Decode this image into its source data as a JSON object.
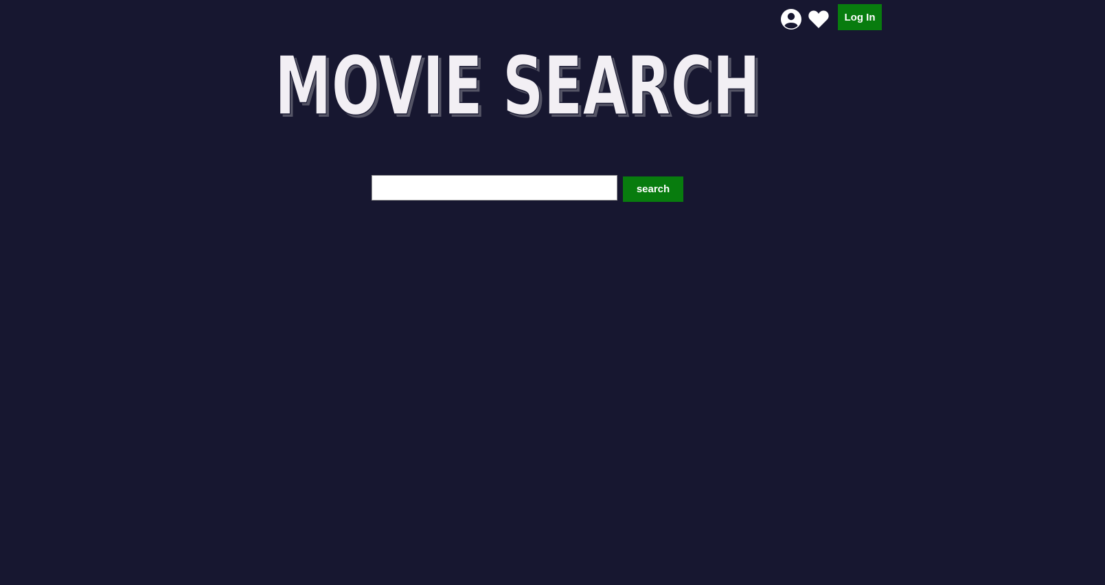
{
  "header": {
    "user_icon": "user-circle-icon",
    "favorites_icon": "heart-icon",
    "login_label": "Log In"
  },
  "logo": {
    "text": "MOVIE SEARCH"
  },
  "search": {
    "value": "",
    "placeholder": "",
    "button_label": "search"
  },
  "colors": {
    "background": "#171730",
    "accent": "#087c0e",
    "logo_fill": "#f2eff4",
    "icon": "#ffffff"
  }
}
